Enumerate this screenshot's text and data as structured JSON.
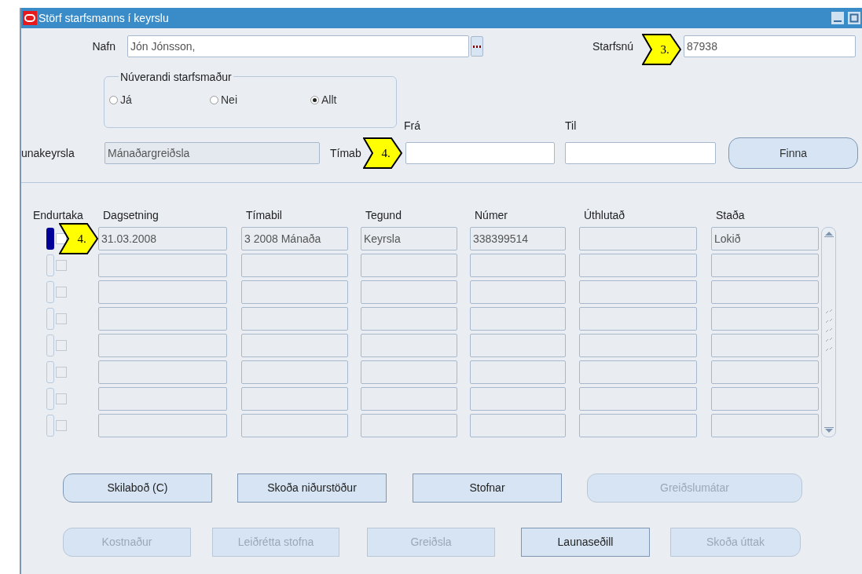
{
  "window": {
    "title": "Störf starfsmanns í keyrslu"
  },
  "name_field": {
    "label": "Nafn",
    "value": "Jón Jónsson,"
  },
  "employee_number": {
    "label": "Starfsnú",
    "value": "87938"
  },
  "current_employee": {
    "legend": "Núverandi starfsmaður",
    "options": [
      {
        "label": "Já",
        "selected": false
      },
      {
        "label": "Nei",
        "selected": false
      },
      {
        "label": "Allt",
        "selected": true
      }
    ]
  },
  "payroll_run": {
    "label": "unakeyrsla",
    "value": "Mánaðargreiðsla",
    "disabled": true
  },
  "period": {
    "label": "Tímab",
    "from_label": "Frá",
    "to_label": "Til"
  },
  "find_button": {
    "label": "Finna"
  },
  "table": {
    "columns": [
      "Endurtaka",
      "Dagsetning",
      "Tímabil",
      "Tegund",
      "Númer",
      "Úthlutað",
      "Staða"
    ],
    "rows": [
      {
        "selected": true,
        "checked": false,
        "cells": [
          "31.03.2008",
          "3 2008 Mánaða",
          "Keyrsla",
          "338399514",
          null,
          "Lokið"
        ]
      },
      {
        "selected": false,
        "checked": false
      },
      {
        "selected": false,
        "checked": false
      },
      {
        "selected": false,
        "checked": false
      },
      {
        "selected": false,
        "checked": false
      },
      {
        "selected": false,
        "checked": false
      },
      {
        "selected": false,
        "checked": false
      },
      {
        "selected": false,
        "checked": false
      }
    ]
  },
  "buttons": [
    [
      {
        "label": "Skilaboð (C)",
        "disabled": false
      },
      {
        "label": "Skoða niðurstöður",
        "disabled": false
      },
      {
        "label": "Stofnar",
        "disabled": false
      },
      {
        "label": "Greiðslumátar",
        "disabled": true
      }
    ],
    [
      {
        "label": "Kostnaður",
        "disabled": true
      },
      {
        "label": "Leiðrétta stofna",
        "disabled": true
      },
      {
        "label": "Greiðsla",
        "disabled": true
      },
      {
        "label": "Launaseðill",
        "disabled": false
      },
      {
        "label": "Skoða úttak",
        "disabled": true
      }
    ]
  ],
  "callouts": [
    {
      "text": "3."
    },
    {
      "text": "4."
    },
    {
      "text": "4."
    }
  ]
}
